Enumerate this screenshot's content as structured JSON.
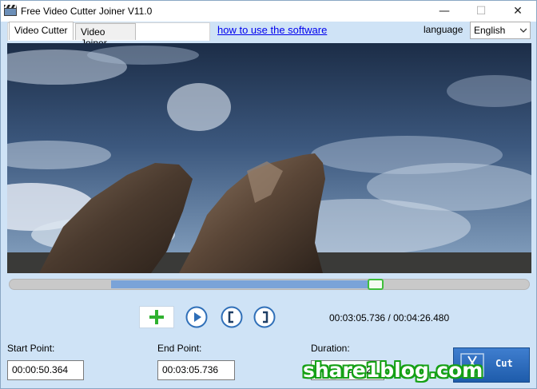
{
  "window": {
    "title": "Free Video Cutter Joiner V11.0",
    "minimize_glyph": "—",
    "maximize_glyph": "☐",
    "close_glyph": "✕"
  },
  "tabs": [
    {
      "label": "Video Cutter",
      "active": true
    },
    {
      "label": "Video Joiner",
      "active": false
    }
  ],
  "help_link": "how to use the software",
  "language": {
    "label": "language",
    "selected": "English"
  },
  "timeline": {
    "selection_start_fraction": 0.196,
    "selection_end_fraction": 0.705,
    "playhead_fraction": 0.705
  },
  "controls": {
    "add_icon": "plus-icon",
    "play_icon": "play-icon",
    "mark_start_icon": "bracket-open-icon",
    "mark_end_icon": "bracket-close-icon",
    "time_readout": "00:03:05.736 / 00:04:26.480"
  },
  "fields": {
    "start_label": "Start Point:",
    "start_value": "00:00:50.364",
    "end_label": "End Point:",
    "end_value": "00:03:05.736",
    "duration_label": "Duration:",
    "duration_value": "00:02:15.372"
  },
  "cut_button": {
    "label": "Cut",
    "icon": "scissors-icon"
  },
  "watermark": "share1blog.com",
  "colors": {
    "window_bg": "#cfe3f6",
    "timeline_selection": "#7aa3d8",
    "playhead_border": "#3fbf3a",
    "cut_button": "#2a6bbd",
    "link": "#0000ee",
    "watermark_outline": "#15a015"
  }
}
